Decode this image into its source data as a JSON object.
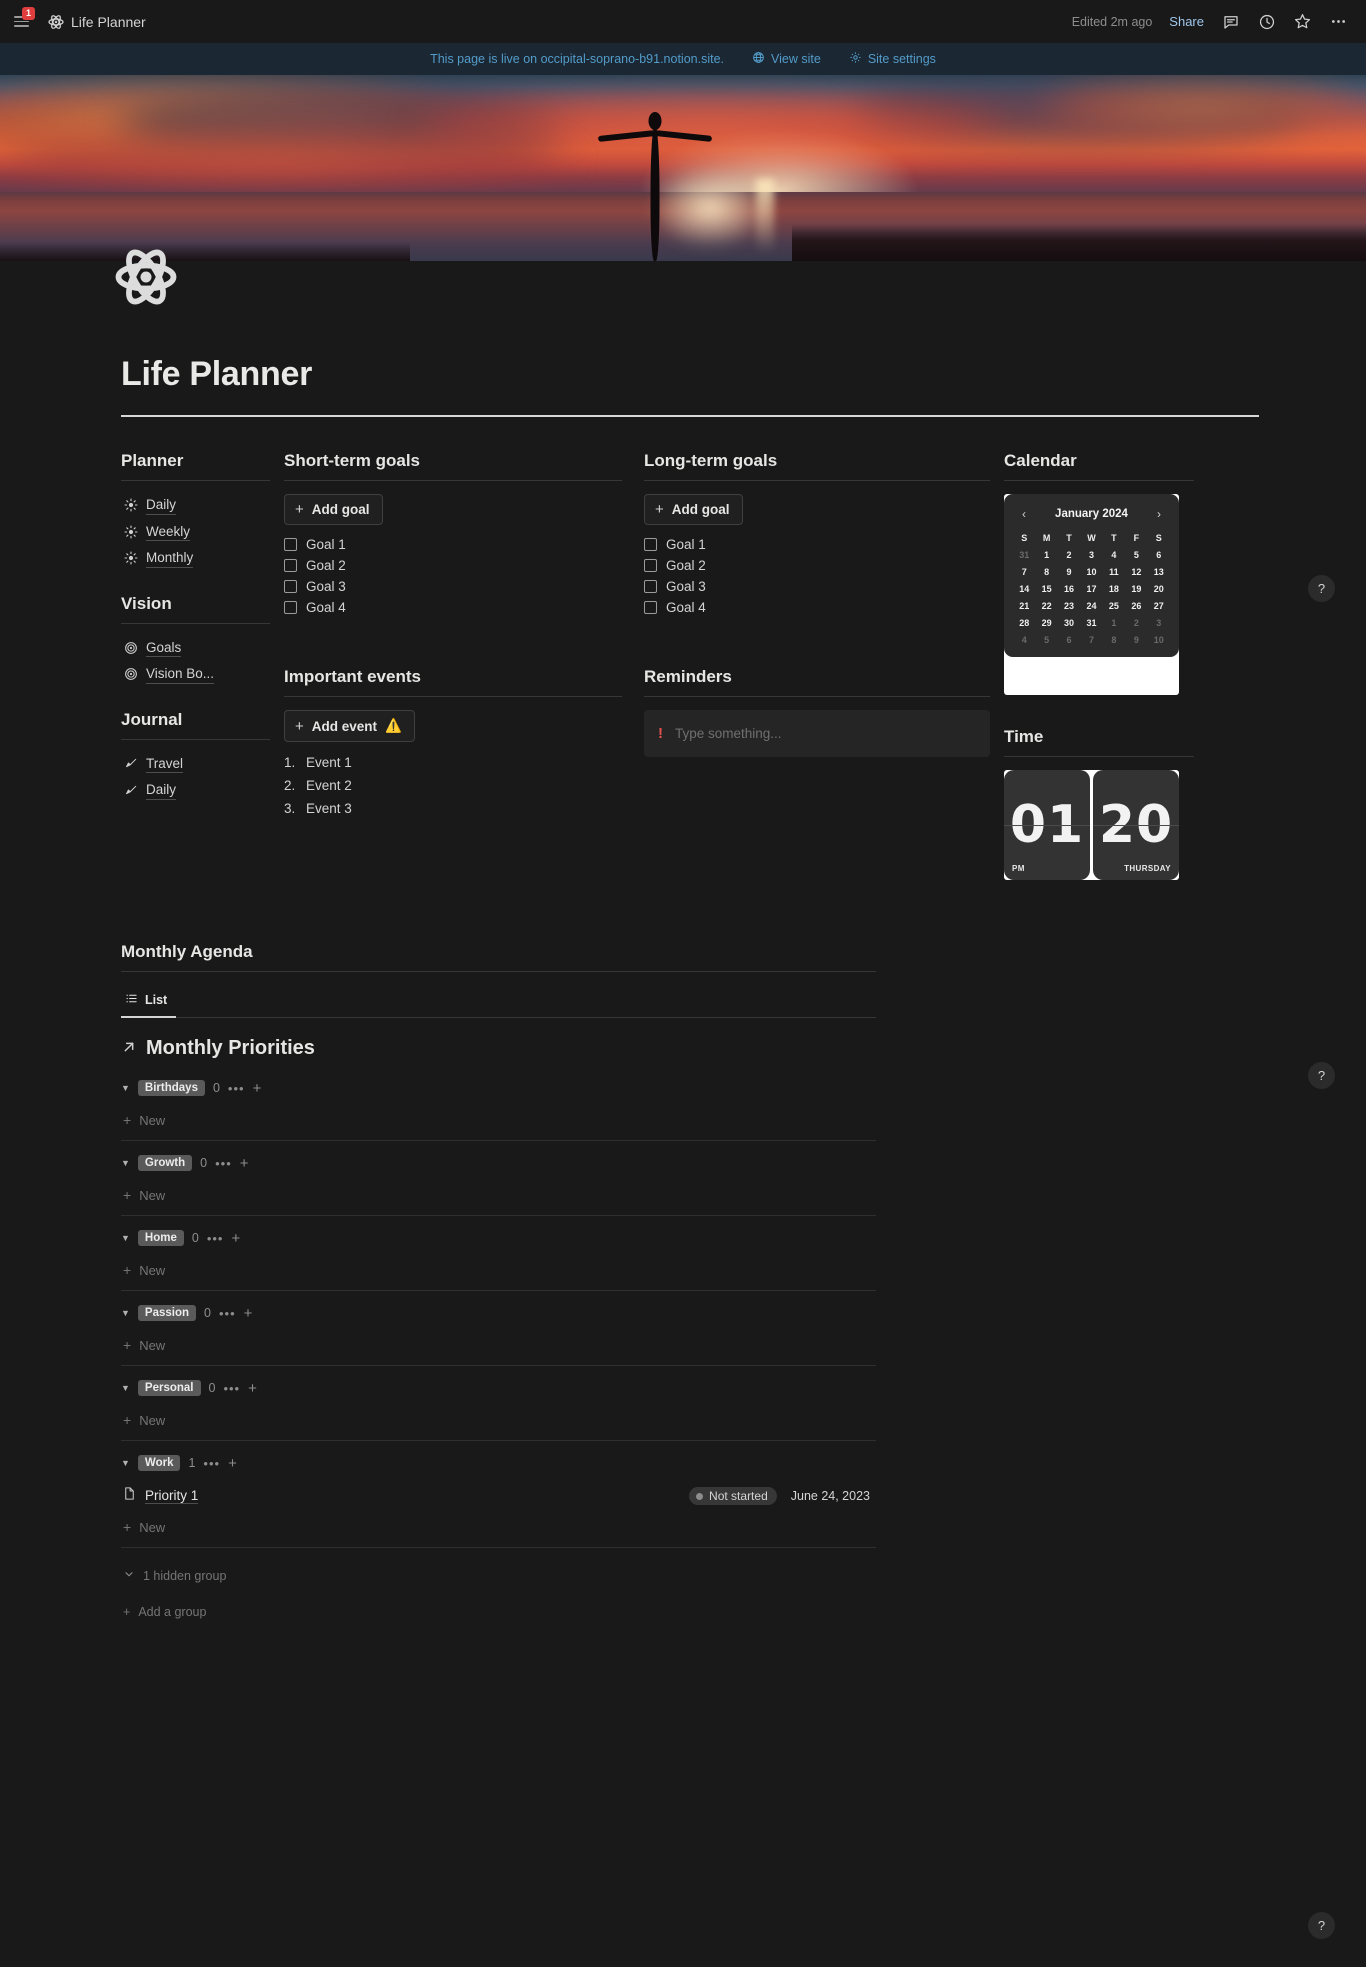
{
  "topbar": {
    "notification_count": "1",
    "page_title": "Life Planner",
    "edited": "Edited 2m ago",
    "share_label": "Share",
    "icons": [
      "menu-icon",
      "atom-icon",
      "comment-icon",
      "clock-icon",
      "star-icon",
      "more-icon"
    ]
  },
  "livebar": {
    "message": "This page is live on occipital-soprano-b91.notion.site.",
    "view_site": "View site",
    "site_settings": "Site settings"
  },
  "page": {
    "title": "Life Planner",
    "icon": "atom-icon"
  },
  "sidebar": {
    "groups": [
      {
        "heading": "Planner",
        "items": [
          {
            "label": "Daily",
            "icon": "sun-icon"
          },
          {
            "label": "Weekly",
            "icon": "sun-icon"
          },
          {
            "label": "Monthly",
            "icon": "sun-icon"
          }
        ]
      },
      {
        "heading": "Vision",
        "items": [
          {
            "label": "Goals",
            "icon": "target-icon"
          },
          {
            "label": "Vision Bo...",
            "icon": "target-icon"
          }
        ]
      },
      {
        "heading": "Journal",
        "items": [
          {
            "label": "Travel",
            "icon": "brush-icon"
          },
          {
            "label": "Daily",
            "icon": "brush-icon"
          }
        ]
      }
    ]
  },
  "short_term_goals": {
    "heading": "Short-term goals",
    "add_label": "Add goal",
    "items": [
      "Goal 1",
      "Goal 2",
      "Goal 3",
      "Goal 4"
    ]
  },
  "long_term_goals": {
    "heading": "Long-term goals",
    "add_label": "Add goal",
    "items": [
      "Goal 1",
      "Goal 2",
      "Goal 3",
      "Goal 4"
    ]
  },
  "important_events": {
    "heading": "Important events",
    "add_label": "Add event",
    "add_emoji": "⚠️",
    "items": [
      "Event 1",
      "Event 2",
      "Event 3"
    ],
    "numbers": [
      "1.",
      "2.",
      "3."
    ]
  },
  "reminders": {
    "heading": "Reminders",
    "bang": "!",
    "placeholder": "Type something..."
  },
  "calendar": {
    "heading": "Calendar",
    "month_title": "January 2024",
    "prev": "‹",
    "next": "›",
    "weekdays": [
      "S",
      "M",
      "T",
      "W",
      "T",
      "F",
      "S"
    ],
    "weeks": [
      [
        {
          "d": "31",
          "muted": true
        },
        {
          "d": "1"
        },
        {
          "d": "2"
        },
        {
          "d": "3"
        },
        {
          "d": "4"
        },
        {
          "d": "5"
        },
        {
          "d": "6"
        }
      ],
      [
        {
          "d": "7"
        },
        {
          "d": "8"
        },
        {
          "d": "9"
        },
        {
          "d": "10"
        },
        {
          "d": "11"
        },
        {
          "d": "12"
        },
        {
          "d": "13"
        }
      ],
      [
        {
          "d": "14"
        },
        {
          "d": "15"
        },
        {
          "d": "16"
        },
        {
          "d": "17"
        },
        {
          "d": "18"
        },
        {
          "d": "19"
        },
        {
          "d": "20"
        }
      ],
      [
        {
          "d": "21"
        },
        {
          "d": "22"
        },
        {
          "d": "23"
        },
        {
          "d": "24"
        },
        {
          "d": "25"
        },
        {
          "d": "26"
        },
        {
          "d": "27"
        }
      ],
      [
        {
          "d": "28"
        },
        {
          "d": "29"
        },
        {
          "d": "30"
        },
        {
          "d": "31"
        },
        {
          "d": "1",
          "muted": true
        },
        {
          "d": "2",
          "muted": true
        },
        {
          "d": "3",
          "muted": true
        }
      ],
      [
        {
          "d": "4",
          "muted": true
        },
        {
          "d": "5",
          "muted": true
        },
        {
          "d": "6",
          "muted": true
        },
        {
          "d": "7",
          "muted": true
        },
        {
          "d": "8",
          "muted": true
        },
        {
          "d": "9",
          "muted": true
        },
        {
          "d": "10",
          "muted": true
        }
      ]
    ]
  },
  "time": {
    "heading": "Time",
    "hours": "01",
    "minutes": "20",
    "meridiem": "PM",
    "weekday": "THURSDAY"
  },
  "agenda": {
    "heading": "Monthly Agenda",
    "tab_label": "List",
    "tab_icon": "list-icon",
    "db_title": "Monthly Priorities",
    "db_title_icon": "arrow-up-right-icon",
    "new_label": "New",
    "hidden_group_label": "1 hidden group",
    "add_group_label": "Add a group",
    "groups": [
      {
        "name": "Birthdays",
        "count": "0",
        "rows": []
      },
      {
        "name": "Growth",
        "count": "0",
        "rows": []
      },
      {
        "name": "Home",
        "count": "0",
        "rows": []
      },
      {
        "name": "Passion",
        "count": "0",
        "rows": []
      },
      {
        "name": "Personal",
        "count": "0",
        "rows": []
      },
      {
        "name": "Work",
        "count": "1",
        "rows": [
          {
            "name": "Priority 1",
            "status": "Not started",
            "date": "June 24, 2023"
          }
        ]
      }
    ]
  },
  "help": {
    "label": "?"
  },
  "colors": {
    "accent_link": "#529cca",
    "page_bg": "#191919",
    "alert_red": "#e03e3e",
    "chip_bg": "#5a5a5a"
  }
}
